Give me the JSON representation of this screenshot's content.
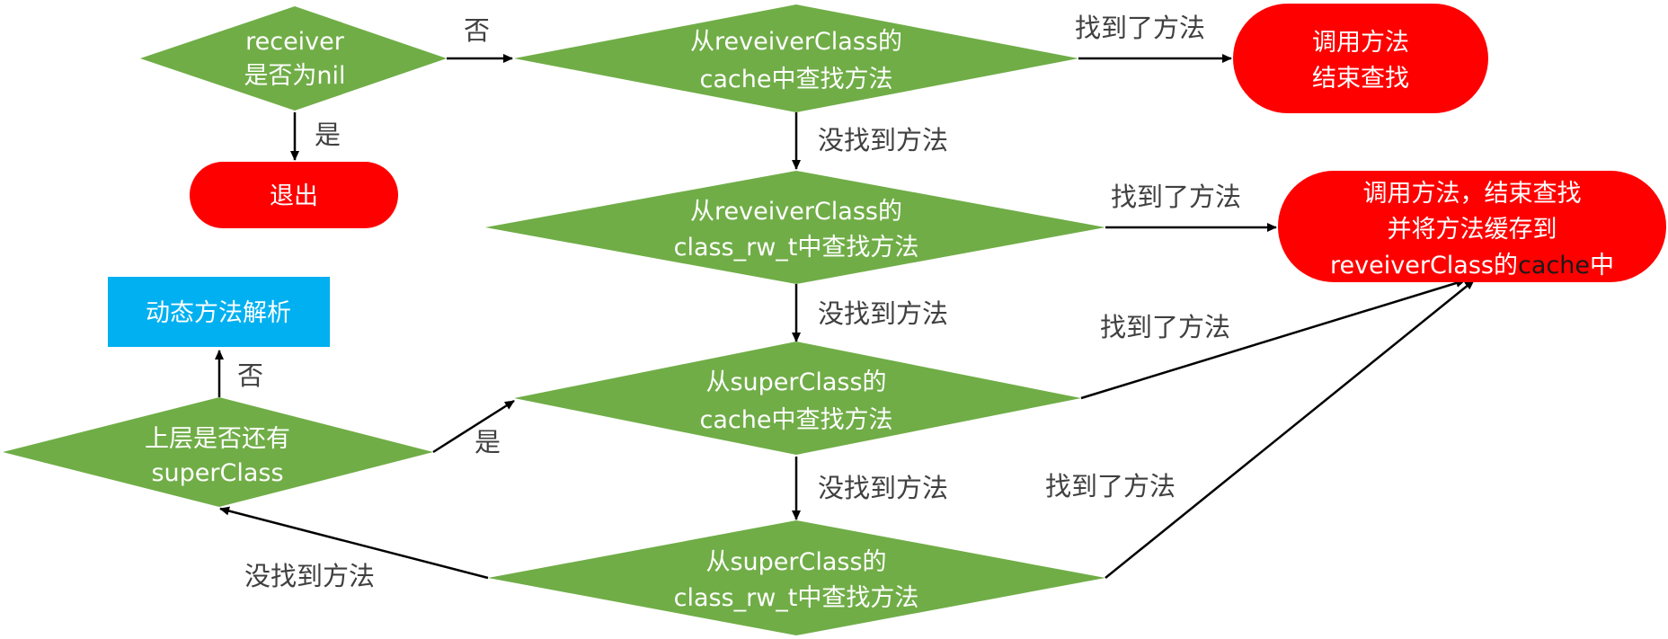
{
  "colors": {
    "decision": "#70ad47",
    "terminal": "#ff0000",
    "process": "#00b0f0",
    "node_text": "#ffffff",
    "highlight_text": "#1a1a1a",
    "edge_label": "#404040",
    "connector": "#000000"
  },
  "nodes": {
    "receiver_nil": {
      "lines": [
        "receiver",
        "是否为nil"
      ]
    },
    "exit": {
      "label": "退出"
    },
    "cache_lookup": {
      "lines": [
        "从reveiverClass的",
        "cache中查找方法"
      ]
    },
    "call_end": {
      "lines": [
        "调用方法",
        "结束查找"
      ]
    },
    "rw_lookup": {
      "lines": [
        "从reveiverClass的",
        "class_rw_t中查找方法"
      ]
    },
    "call_cache": {
      "line1": "调用方法，结束查找",
      "line2": "并将方法缓存到",
      "line3_prefix": "reveiverClass的",
      "line3_highlight": "cache",
      "line3_suffix": "中"
    },
    "dynamic_resolution": {
      "label": "动态方法解析"
    },
    "super_cache_lookup": {
      "lines": [
        "从superClass的",
        "cache中查找方法"
      ]
    },
    "has_superclass": {
      "lines": [
        "上层是否还有",
        "superClass"
      ]
    },
    "super_rw_lookup": {
      "lines": [
        "从superClass的",
        "class_rw_t中查找方法"
      ]
    }
  },
  "edges": {
    "no_1": "否",
    "yes_1": "是",
    "found_1": "找到了方法",
    "not_found_1": "没找到方法",
    "found_2": "找到了方法",
    "not_found_2": "没找到方法",
    "found_3": "找到了方法",
    "not_found_3": "没找到方法",
    "found_4": "找到了方法",
    "not_found_4": "没找到方法",
    "no_2": "否",
    "yes_2": "是"
  }
}
